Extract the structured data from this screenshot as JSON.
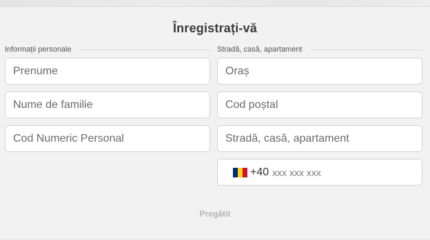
{
  "form": {
    "title": "Înregistrați-vă",
    "sections": {
      "personal": "Informații personale",
      "address": "Stradă, casă, apartament"
    },
    "fields": {
      "first_name": {
        "placeholder": "Prenume",
        "value": ""
      },
      "last_name": {
        "placeholder": "Nume de familie",
        "value": ""
      },
      "cnp": {
        "placeholder": "Cod Numeric Personal",
        "value": ""
      },
      "city": {
        "placeholder": "Oraș",
        "value": ""
      },
      "postal_code": {
        "placeholder": "Cod poștal",
        "value": ""
      },
      "street": {
        "placeholder": "Stradă, casă, apartament",
        "value": ""
      },
      "phone": {
        "country_code": "+40",
        "placeholder": "xxx xxx xxx",
        "value": "",
        "flag_icon": "romania-flag-icon",
        "flag_colors": [
          "#002b7f",
          "#fcd116",
          "#ce1126"
        ]
      }
    },
    "submit_label": "Pregătit"
  },
  "colors": {
    "background": "#f2f2f2",
    "field_border": "#d2d2d2",
    "title": "#3a3a3a",
    "submit_disabled": "#b3b3b3"
  }
}
